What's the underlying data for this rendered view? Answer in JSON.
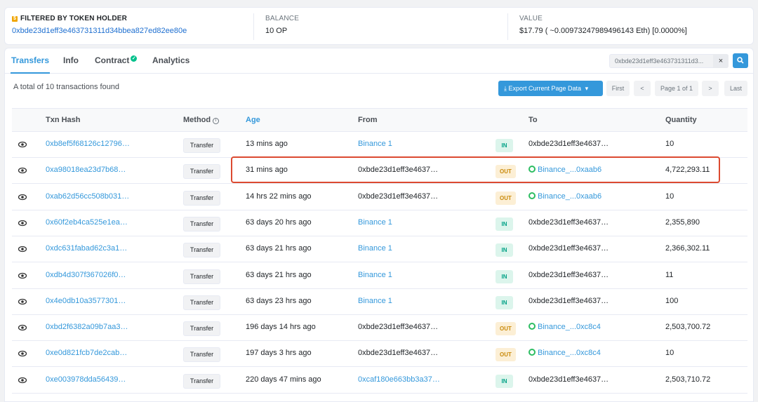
{
  "summary": {
    "filter_label": "FILTERED BY TOKEN HOLDER",
    "holder_icon": "token-holder-icon",
    "holder_address": "0xbde23d1eff3e463731311d34bbea827ed82ee80e",
    "balance_label": "BALANCE",
    "balance_value": "10 OP",
    "value_label": "VALUE",
    "value_value": "$17.79 ( ~0.00973247989496143 Eth) [0.0000%]"
  },
  "tabs": [
    {
      "label": "Transfers",
      "active": true
    },
    {
      "label": "Info"
    },
    {
      "label": "Contract",
      "verified": true
    },
    {
      "label": "Analytics"
    }
  ],
  "filter_text": "0xbde23d1eff3e463731311d3...",
  "clear_icon": "×",
  "total_text": "A total of 10 transactions found",
  "export_label": "Export Current Page Data",
  "pagination": {
    "first": "First",
    "prev": "<",
    "page": "Page 1 of 1",
    "next": ">",
    "last": "Last"
  },
  "columns": [
    "Txn Hash",
    "Method",
    "Age",
    "From",
    "To",
    "Quantity"
  ],
  "accent_color": "#3498db",
  "highlight_color": "#dc4a31",
  "rows": [
    {
      "hash": "0xb8ef5f68126c12796…",
      "method": "Transfer",
      "age": "13 mins ago",
      "from": "Binance 1",
      "from_link": true,
      "dir": "IN",
      "to": "0xbde23d1eff3e4637…",
      "to_link": false,
      "qty": "10"
    },
    {
      "hash": "0xa98018ea23d7b68…",
      "method": "Transfer",
      "age": "31 mins ago",
      "from": "0xbde23d1eff3e4637…",
      "from_link": false,
      "dir": "OUT",
      "to": "Binance_...0xaab6",
      "to_link": true,
      "qty": "4,722,293.11"
    },
    {
      "hash": "0xab62d56cc508b031…",
      "method": "Transfer",
      "age": "14 hrs 22 mins ago",
      "from": "0xbde23d1eff3e4637…",
      "from_link": false,
      "dir": "OUT",
      "to": "Binance_...0xaab6",
      "to_link": true,
      "qty": "10"
    },
    {
      "hash": "0x60f2eb4ca525e1ea…",
      "method": "Transfer",
      "age": "63 days 20 hrs ago",
      "from": "Binance 1",
      "from_link": true,
      "dir": "IN",
      "to": "0xbde23d1eff3e4637…",
      "to_link": false,
      "qty": "2,355,890"
    },
    {
      "hash": "0xdc631fabad62c3a1…",
      "method": "Transfer",
      "age": "63 days 21 hrs ago",
      "from": "Binance 1",
      "from_link": true,
      "dir": "IN",
      "to": "0xbde23d1eff3e4637…",
      "to_link": false,
      "qty": "2,366,302.11"
    },
    {
      "hash": "0xdb4d307f367026f0…",
      "method": "Transfer",
      "age": "63 days 21 hrs ago",
      "from": "Binance 1",
      "from_link": true,
      "dir": "IN",
      "to": "0xbde23d1eff3e4637…",
      "to_link": false,
      "qty": "11"
    },
    {
      "hash": "0x4e0db10a3577301…",
      "method": "Transfer",
      "age": "63 days 23 hrs ago",
      "from": "Binance 1",
      "from_link": true,
      "dir": "IN",
      "to": "0xbde23d1eff3e4637…",
      "to_link": false,
      "qty": "100"
    },
    {
      "hash": "0xbd2f6382a09b7aa3…",
      "method": "Transfer",
      "age": "196 days 14 hrs ago",
      "from": "0xbde23d1eff3e4637…",
      "from_link": false,
      "dir": "OUT",
      "to": "Binance_...0xc8c4",
      "to_link": true,
      "qty": "2,503,700.72"
    },
    {
      "hash": "0xe0d821fcb7de2cab…",
      "method": "Transfer",
      "age": "197 days 3 hrs ago",
      "from": "0xbde23d1eff3e4637…",
      "from_link": false,
      "dir": "OUT",
      "to": "Binance_...0xc8c4",
      "to_link": true,
      "qty": "10"
    },
    {
      "hash": "0xe003978dda56439…",
      "method": "Transfer",
      "age": "220 days 47 mins ago",
      "from": "0xcaf180e663bb3a37…",
      "from_link": true,
      "dir": "IN",
      "to": "0xbde23d1eff3e4637…",
      "to_link": false,
      "qty": "2,503,710.72"
    }
  ]
}
